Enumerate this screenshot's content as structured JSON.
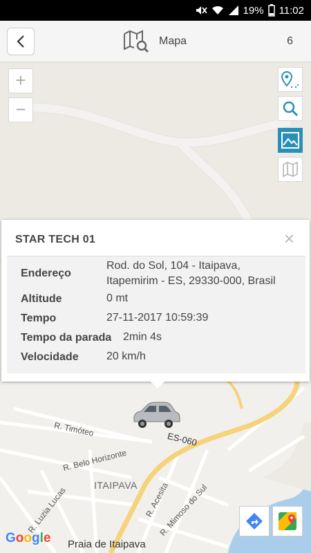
{
  "status_bar": {
    "battery": "19%",
    "time": "11:02"
  },
  "header": {
    "title": "Mapa",
    "count": "6"
  },
  "map": {
    "zoom_in": "+",
    "zoom_out": "−",
    "streets": [
      "R. Timóteo",
      "R. Belo Horizonte",
      "R. Luzia Lucas",
      "R. Acesita",
      "R. Mimoso do Sul",
      "ES-060"
    ],
    "district": "ITAIPAVA",
    "place": "Praia de Itaipava",
    "google": "Google"
  },
  "popup": {
    "title": "STAR TECH 01",
    "close": "×",
    "rows": [
      {
        "label": "Endereço",
        "value": "Rod. do Sol, 104 - Itaipava, Itapemirim - ES, 29330-000, Brasil"
      },
      {
        "label": "Altitude",
        "value": "0 mt"
      },
      {
        "label": "Tempo",
        "value": "27-11-2017 10:59:39"
      },
      {
        "label": "Tempo da parada",
        "value": "2min 4s"
      },
      {
        "label": "Velocidade",
        "value": "20 km/h"
      }
    ]
  }
}
